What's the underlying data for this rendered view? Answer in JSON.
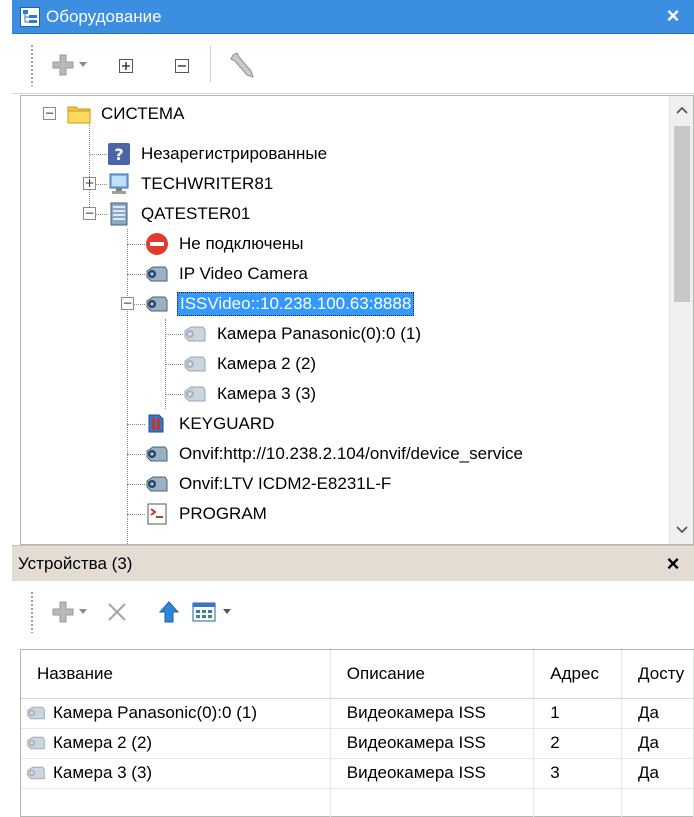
{
  "equipment_panel": {
    "title": "Оборудование",
    "close_glyph": "×",
    "toolbar": {
      "icons": [
        "add-icon",
        "dropdown-arrow-icon",
        "expand-all-icon",
        "collapse-all-icon",
        "wrench-icon"
      ]
    },
    "tree": {
      "items": [
        {
          "label": "СИСТЕМА",
          "icon": "folder-icon"
        },
        {
          "label": "Незарегистрированные",
          "icon": "question-icon"
        },
        {
          "label": "TECHWRITER81",
          "icon": "computer-icon"
        },
        {
          "label": "QATESTER01",
          "icon": "server-icon"
        },
        {
          "label": "Не подключены",
          "icon": "no-entry-icon"
        },
        {
          "label": "IP Video Camera",
          "icon": "camera-icon"
        },
        {
          "label": "ISSVideo::10.238.100.63:8888",
          "icon": "camera-icon"
        },
        {
          "label": "Камера Panasonic(0):0 (1)",
          "icon": "camera-icon"
        },
        {
          "label": "Камера 2 (2)",
          "icon": "camera-icon"
        },
        {
          "label": "Камера 3 (3)",
          "icon": "camera-icon"
        },
        {
          "label": "KEYGUARD",
          "icon": "keyguard-icon"
        },
        {
          "label": "Onvif:http://10.238.2.104/onvif/device_service",
          "icon": "camera-icon"
        },
        {
          "label": "Onvif:LTV ICDM2-E8231L-F",
          "icon": "camera-icon"
        },
        {
          "label": "PROGRAM",
          "icon": "program-icon"
        }
      ]
    }
  },
  "devices_panel": {
    "title": "Устройства (3)",
    "close_glyph": "×",
    "toolbar": {
      "icons": [
        "add-icon",
        "dropdown-arrow-icon",
        "delete-icon",
        "move-up-icon",
        "columns-icon",
        "dropdown-arrow-icon"
      ]
    },
    "table": {
      "columns": [
        "Название",
        "Описание",
        "Адрес",
        "Досту"
      ],
      "rows": [
        [
          "Камера Panasonic(0):0 (1)",
          "Видеокамера ISS",
          "1",
          "Да"
        ],
        [
          "Камера 2 (2)",
          "Видеокамера ISS",
          "2",
          "Да"
        ],
        [
          "Камера 3 (3)",
          "Видеокамера ISS",
          "3",
          "Да"
        ]
      ]
    }
  },
  "colors": {
    "title_active": "#3c8ee0",
    "title_inactive": "#e2dcd2",
    "selection": "#3399ff"
  }
}
